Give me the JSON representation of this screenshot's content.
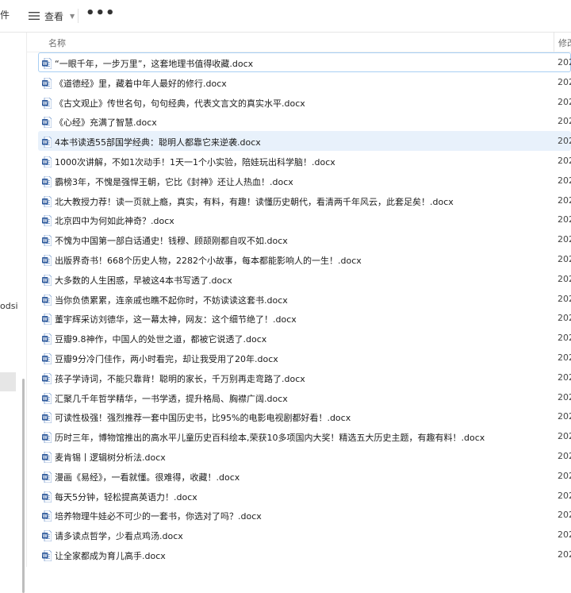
{
  "toolbar": {
    "cut_left_label": "件",
    "view_label": "查看",
    "more_label": "•••",
    "view_icon": "list-view-icon",
    "chevron_icon": "chevron-down-icon"
  },
  "navpane": {
    "partial_label": "odsi"
  },
  "columns": {
    "name": "名称",
    "modified": "修改"
  },
  "colors": {
    "selection_border": "#a8cff4",
    "highlight_bg": "#e8f1fb",
    "word_icon_blue": "#2b579a"
  },
  "file_icon": "word-document-icon",
  "files": [
    {
      "name": "“一眼千年，一步万里”，这套地理书值得收藏.docx",
      "date": "202",
      "state": "selected"
    },
    {
      "name": "《道德经》里，藏着中年人最好的修行.docx",
      "date": "202",
      "state": ""
    },
    {
      "name": "《古文观止》传世名句，句句经典，代表文言文的真实水平.docx",
      "date": "202",
      "state": ""
    },
    {
      "name": "《心经》充满了智慧.docx",
      "date": "202",
      "state": ""
    },
    {
      "name": "4本书读透55部国学经典：聪明人都靠它来逆袭.docx",
      "date": "202",
      "state": "highlight"
    },
    {
      "name": "1000次讲解，不如1次动手！1天一1个小实验，陪娃玩出科学脑！.docx",
      "date": "202",
      "state": ""
    },
    {
      "name": "霸榜3年，不愧是强悍王朝，它比《封神》还让人热血！.docx",
      "date": "202",
      "state": ""
    },
    {
      "name": "北大教授力荐！读一页就上瘾，真实，有料，有趣！读懂历史朝代，看清两千年风云，此套足矣！.docx",
      "date": "202",
      "state": ""
    },
    {
      "name": "北京四中为何如此神奇？.docx",
      "date": "202",
      "state": ""
    },
    {
      "name": "不愧为中国第一部白话通史！钱穆、顾颉刚都自叹不如.docx",
      "date": "202",
      "state": ""
    },
    {
      "name": "出版界奇书！668个历史人物，2282个小故事，每本都能影响人的一生！.docx",
      "date": "202",
      "state": ""
    },
    {
      "name": "大多数的人生困惑，早被这4本书写透了.docx",
      "date": "202",
      "state": ""
    },
    {
      "name": "当你负债累累，连亲戚也瞧不起你时，不妨读读这套书.docx",
      "date": "202",
      "state": ""
    },
    {
      "name": "董宇辉采访刘德华，这一幕太神，网友：这个细节绝了！.docx",
      "date": "202",
      "state": ""
    },
    {
      "name": "豆瓣9.8神作，中国人的处世之道，都被它说透了.docx",
      "date": "202",
      "state": ""
    },
    {
      "name": "豆瓣9分冷门佳作，两小时看完，却让我受用了20年.docx",
      "date": "202",
      "state": ""
    },
    {
      "name": "孩子学诗词，不能只靠背！聪明的家长，千万别再走弯路了.docx",
      "date": "202",
      "state": ""
    },
    {
      "name": "汇聚几千年哲学精华，一书学透，提升格局、胸襟广阔.docx",
      "date": "202",
      "state": ""
    },
    {
      "name": "可读性极强！强烈推荐一套中国历史书，比95%的电影电视剧都好看！.docx",
      "date": "202",
      "state": ""
    },
    {
      "name": "历时三年，博物馆推出的高水平儿童历史百科绘本,荣获10多项国内大奖！精选五大历史主题，有趣有料！.docx",
      "date": "202",
      "state": ""
    },
    {
      "name": "麦肯锡丨逻辑树分析法.docx",
      "date": "202",
      "state": ""
    },
    {
      "name": "漫画《易经》，一看就懂。很难得，收藏！.docx",
      "date": "202",
      "state": ""
    },
    {
      "name": "每天5分钟，轻松提高英语力！.docx",
      "date": "202",
      "state": ""
    },
    {
      "name": "培养物理牛娃必不可少的一套书，你选对了吗？.docx",
      "date": "202",
      "state": ""
    },
    {
      "name": "请多读点哲学，少看点鸡汤.docx",
      "date": "202",
      "state": ""
    },
    {
      "name": "让全家都成为育儿高手.docx",
      "date": "202",
      "state": ""
    }
  ]
}
